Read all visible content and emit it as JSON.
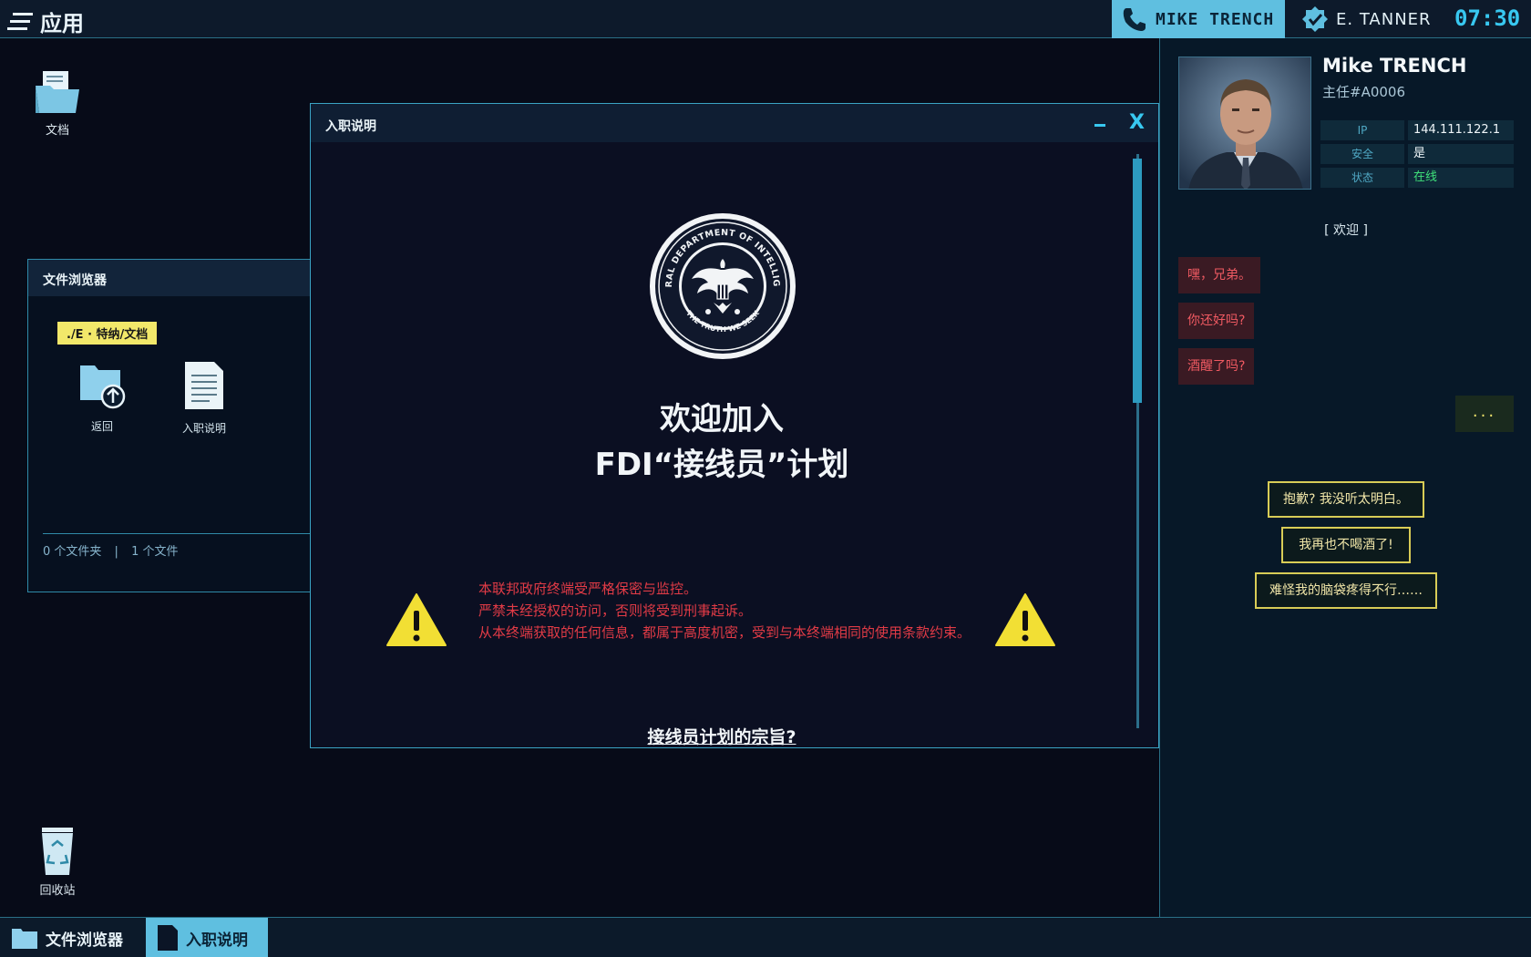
{
  "topbar": {
    "apps_label": "应用",
    "call_name": "MIKE TRENCH",
    "user_name": "E. TANNER",
    "clock": "07:30"
  },
  "desktop": {
    "docs_label": "文档",
    "recycle_label": "回收站"
  },
  "file_browser": {
    "title": "文件浏览器",
    "path": "./E · 特纳/文档",
    "items": [
      {
        "label": "返回",
        "icon": "folder-up-icon"
      },
      {
        "label": "入职说明",
        "icon": "document-icon"
      }
    ],
    "status_folders": "0 个文件夹",
    "status_sep": "|",
    "status_files": "1 个文件"
  },
  "dialog": {
    "title": "入职说明",
    "welcome_line1": "欢迎加入",
    "welcome_line2": "FDI“接线员”计划",
    "warning_lines": [
      "本联邦政府终端受严格保密与监控。",
      "严禁未经授权的访问，否则将受到刑事起诉。",
      "从本终端获取的任何信息，都属于高度机密，受到与本终端相同的使用条款约束。"
    ],
    "link": "接线员计划的宗旨?",
    "seal_top_text": "FEDERAL DEPARTMENT OF INTELLIGENCE",
    "seal_bottom_text": "THE TRUTH WE SEEK"
  },
  "contact": {
    "name": "Mike TRENCH",
    "role": "主任#A0006",
    "info": [
      {
        "key": "IP",
        "value": "144.111.122.1"
      },
      {
        "key": "安全",
        "value": "是"
      },
      {
        "key": "状态",
        "value": "在线"
      }
    ],
    "welcome_tag": "[ 欢迎 ]",
    "messages": [
      "嘿，兄弟。",
      "你还好吗?",
      "酒醒了吗?"
    ],
    "typing": "...",
    "replies": [
      "抱歉? 我没听太明白。",
      "我再也不喝酒了!",
      "难怪我的脑袋疼得不行……"
    ]
  },
  "taskbar": {
    "items": [
      {
        "label": "文件浏览器",
        "active": false
      },
      {
        "label": "入职说明",
        "active": true
      }
    ]
  },
  "colors": {
    "accent": "#38c8f0",
    "warning_text": "#e23b46",
    "online": "#3fe07a",
    "reply_border": "#d8cc56"
  }
}
